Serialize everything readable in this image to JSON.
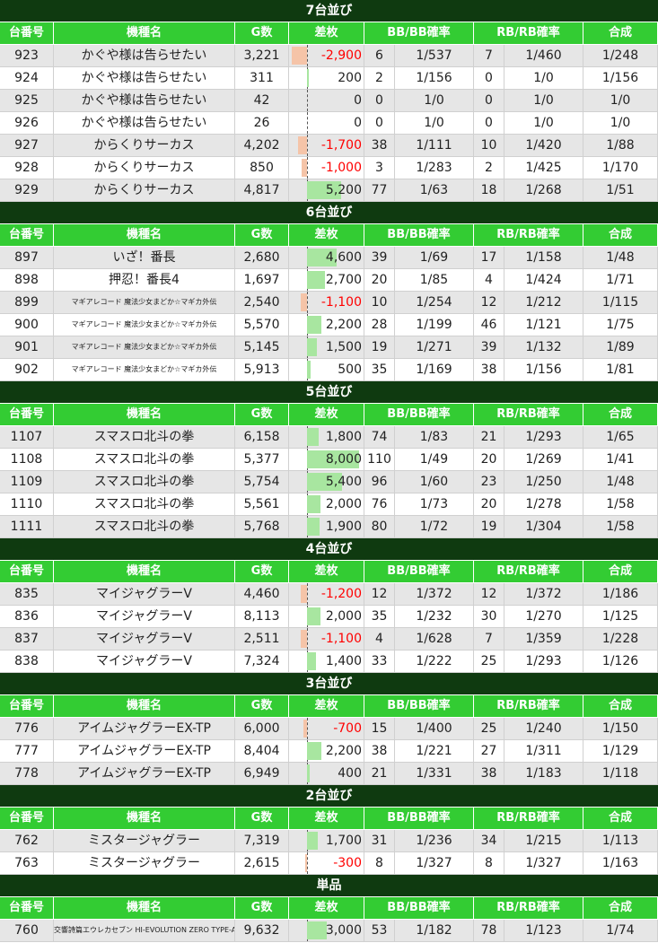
{
  "columns": [
    "台番号",
    "機種名",
    "G数",
    "差枚",
    "BB/BB確率",
    "RB/RB確率",
    "合成"
  ],
  "colors": {
    "section_bg": "#0f3a10",
    "header_bg": "#33cc33",
    "positive_bar": "#a8e6a0",
    "negative_bar": "#f5c4a8",
    "negative_text": "#ff0000"
  },
  "sections": [
    {
      "title": "7台並び",
      "rows": [
        {
          "num": "923",
          "name": "かぐや様は告らせたい",
          "g": "3,221",
          "diff": "-2,900",
          "diff_value": -2900,
          "bb": "6",
          "bb_rate": "1/537",
          "rb": "7",
          "rb_rate": "1/460",
          "total": "1/248"
        },
        {
          "num": "924",
          "name": "かぐや様は告らせたい",
          "g": "311",
          "diff": "200",
          "diff_value": 200,
          "bb": "2",
          "bb_rate": "1/156",
          "rb": "0",
          "rb_rate": "1/0",
          "total": "1/156"
        },
        {
          "num": "925",
          "name": "かぐや様は告らせたい",
          "g": "42",
          "diff": "0",
          "diff_value": 0,
          "bb": "0",
          "bb_rate": "1/0",
          "rb": "0",
          "rb_rate": "1/0",
          "total": "1/0"
        },
        {
          "num": "926",
          "name": "かぐや様は告らせたい",
          "g": "26",
          "diff": "0",
          "diff_value": 0,
          "bb": "0",
          "bb_rate": "1/0",
          "rb": "0",
          "rb_rate": "1/0",
          "total": "1/0"
        },
        {
          "num": "927",
          "name": "からくりサーカス",
          "g": "4,202",
          "diff": "-1,700",
          "diff_value": -1700,
          "bb": "38",
          "bb_rate": "1/111",
          "rb": "10",
          "rb_rate": "1/420",
          "total": "1/88"
        },
        {
          "num": "928",
          "name": "からくりサーカス",
          "g": "850",
          "diff": "-1,000",
          "diff_value": -1000,
          "bb": "3",
          "bb_rate": "1/283",
          "rb": "2",
          "rb_rate": "1/425",
          "total": "1/170"
        },
        {
          "num": "929",
          "name": "からくりサーカス",
          "g": "4,817",
          "diff": "5,200",
          "diff_value": 5200,
          "bb": "77",
          "bb_rate": "1/63",
          "rb": "18",
          "rb_rate": "1/268",
          "total": "1/51"
        }
      ]
    },
    {
      "title": "6台並び",
      "rows": [
        {
          "num": "897",
          "name": "いざ！番長",
          "g": "2,680",
          "diff": "4,600",
          "diff_value": 4600,
          "bb": "39",
          "bb_rate": "1/69",
          "rb": "17",
          "rb_rate": "1/158",
          "total": "1/48"
        },
        {
          "num": "898",
          "name": "押忍！番長4",
          "g": "1,697",
          "diff": "2,700",
          "diff_value": 2700,
          "bb": "20",
          "bb_rate": "1/85",
          "rb": "4",
          "rb_rate": "1/424",
          "total": "1/71"
        },
        {
          "num": "899",
          "name": "マギアレコード 魔法少女まどか☆マギカ外伝",
          "small": true,
          "g": "2,540",
          "diff": "-1,100",
          "diff_value": -1100,
          "bb": "10",
          "bb_rate": "1/254",
          "rb": "12",
          "rb_rate": "1/212",
          "total": "1/115"
        },
        {
          "num": "900",
          "name": "マギアレコード 魔法少女まどか☆マギカ外伝",
          "small": true,
          "g": "5,570",
          "diff": "2,200",
          "diff_value": 2200,
          "bb": "28",
          "bb_rate": "1/199",
          "rb": "46",
          "rb_rate": "1/121",
          "total": "1/75"
        },
        {
          "num": "901",
          "name": "マギアレコード 魔法少女まどか☆マギカ外伝",
          "small": true,
          "g": "5,145",
          "diff": "1,500",
          "diff_value": 1500,
          "bb": "19",
          "bb_rate": "1/271",
          "rb": "39",
          "rb_rate": "1/132",
          "total": "1/89"
        },
        {
          "num": "902",
          "name": "マギアレコード 魔法少女まどか☆マギカ外伝",
          "small": true,
          "g": "5,913",
          "diff": "500",
          "diff_value": 500,
          "bb": "35",
          "bb_rate": "1/169",
          "rb": "38",
          "rb_rate": "1/156",
          "total": "1/81"
        }
      ]
    },
    {
      "title": "5台並び",
      "rows": [
        {
          "num": "1107",
          "name": "スマスロ北斗の拳",
          "g": "6,158",
          "diff": "1,800",
          "diff_value": 1800,
          "bb": "74",
          "bb_rate": "1/83",
          "rb": "21",
          "rb_rate": "1/293",
          "total": "1/65"
        },
        {
          "num": "1108",
          "name": "スマスロ北斗の拳",
          "g": "5,377",
          "diff": "8,000",
          "diff_value": 8000,
          "bb": "110",
          "bb_rate": "1/49",
          "rb": "20",
          "rb_rate": "1/269",
          "total": "1/41"
        },
        {
          "num": "1109",
          "name": "スマスロ北斗の拳",
          "g": "5,754",
          "diff": "5,400",
          "diff_value": 5400,
          "bb": "96",
          "bb_rate": "1/60",
          "rb": "23",
          "rb_rate": "1/250",
          "total": "1/48"
        },
        {
          "num": "1110",
          "name": "スマスロ北斗の拳",
          "g": "5,561",
          "diff": "2,000",
          "diff_value": 2000,
          "bb": "76",
          "bb_rate": "1/73",
          "rb": "20",
          "rb_rate": "1/278",
          "total": "1/58"
        },
        {
          "num": "1111",
          "name": "スマスロ北斗の拳",
          "g": "5,768",
          "diff": "1,900",
          "diff_value": 1900,
          "bb": "80",
          "bb_rate": "1/72",
          "rb": "19",
          "rb_rate": "1/304",
          "total": "1/58"
        }
      ]
    },
    {
      "title": "4台並び",
      "rows": [
        {
          "num": "835",
          "name": "マイジャグラーV",
          "g": "4,460",
          "diff": "-1,200",
          "diff_value": -1200,
          "bb": "12",
          "bb_rate": "1/372",
          "rb": "12",
          "rb_rate": "1/372",
          "total": "1/186"
        },
        {
          "num": "836",
          "name": "マイジャグラーV",
          "g": "8,113",
          "diff": "2,000",
          "diff_value": 2000,
          "bb": "35",
          "bb_rate": "1/232",
          "rb": "30",
          "rb_rate": "1/270",
          "total": "1/125"
        },
        {
          "num": "837",
          "name": "マイジャグラーV",
          "g": "2,511",
          "diff": "-1,100",
          "diff_value": -1100,
          "bb": "4",
          "bb_rate": "1/628",
          "rb": "7",
          "rb_rate": "1/359",
          "total": "1/228"
        },
        {
          "num": "838",
          "name": "マイジャグラーV",
          "g": "7,324",
          "diff": "1,400",
          "diff_value": 1400,
          "bb": "33",
          "bb_rate": "1/222",
          "rb": "25",
          "rb_rate": "1/293",
          "total": "1/126"
        }
      ]
    },
    {
      "title": "3台並び",
      "rows": [
        {
          "num": "776",
          "name": "アイムジャグラーEX-TP",
          "g": "6,000",
          "diff": "-700",
          "diff_value": -700,
          "bb": "15",
          "bb_rate": "1/400",
          "rb": "25",
          "rb_rate": "1/240",
          "total": "1/150"
        },
        {
          "num": "777",
          "name": "アイムジャグラーEX-TP",
          "g": "8,404",
          "diff": "2,200",
          "diff_value": 2200,
          "bb": "38",
          "bb_rate": "1/221",
          "rb": "27",
          "rb_rate": "1/311",
          "total": "1/129"
        },
        {
          "num": "778",
          "name": "アイムジャグラーEX-TP",
          "g": "6,949",
          "diff": "400",
          "diff_value": 400,
          "bb": "21",
          "bb_rate": "1/331",
          "rb": "38",
          "rb_rate": "1/183",
          "total": "1/118"
        }
      ]
    },
    {
      "title": "2台並び",
      "rows": [
        {
          "num": "762",
          "name": "ミスタージャグラー",
          "g": "7,319",
          "diff": "1,700",
          "diff_value": 1700,
          "bb": "31",
          "bb_rate": "1/236",
          "rb": "34",
          "rb_rate": "1/215",
          "total": "1/113"
        },
        {
          "num": "763",
          "name": "ミスタージャグラー",
          "g": "2,615",
          "diff": "-300",
          "diff_value": -300,
          "bb": "8",
          "bb_rate": "1/327",
          "rb": "8",
          "rb_rate": "1/327",
          "total": "1/163"
        }
      ]
    },
    {
      "title": "単品",
      "rows": [
        {
          "num": "760",
          "name": "交響詩篇エウレカセブン HI-EVOLUTION ZERO TYPE-ART",
          "small": true,
          "g": "9,632",
          "diff": "3,000",
          "diff_value": 3000,
          "bb": "53",
          "bb_rate": "1/182",
          "rb": "78",
          "rb_rate": "1/123",
          "total": "1/74"
        }
      ]
    }
  ]
}
